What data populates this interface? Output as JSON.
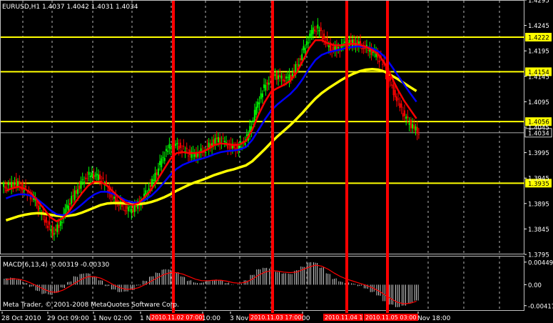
{
  "header": {
    "symbol_line": "EURUSD,H1  1.4037 1.4042 1.4031 1.4034",
    "indicator_line": "MACD(6,13,4) -0.00319 -0.00330"
  },
  "footer": {
    "copyright": "Meta Trader, © 2001-2008 MetaQuotes Software Corp."
  },
  "colors": {
    "background": "#000000",
    "up_candle": "#00ff00",
    "down_candle": "#ff0000",
    "ma_red": "#ff0000",
    "ma_blue": "#0000ff",
    "ma_yellow": "#ffff00",
    "level_line": "#ffff00",
    "event_line": "#ff0000",
    "macd_hist": "#ffffff",
    "signal": "#ff0000"
  },
  "chart_data": [
    {
      "type": "candlestick",
      "title": "EURUSD,H1",
      "ohlc_last": {
        "open": 1.4037,
        "high": 1.4042,
        "low": 1.4031,
        "close": 1.4034
      },
      "ylim": [
        1.3795,
        1.4295
      ],
      "y_ticks": [
        "1.4295",
        "1.4245",
        "1.4195",
        "1.4145",
        "1.4095",
        "1.4045",
        "1.3995",
        "1.3945",
        "1.3895",
        "1.3845",
        "1.3795"
      ],
      "x_ticks": [
        "28 Oct 2010",
        "29 Oct 09:00",
        "1 Nov 02:00",
        "1 N",
        "10:00",
        "3 Nov",
        "00",
        "Nov 18:00"
      ],
      "levels": [
        "1.4222",
        "1.4154",
        "1.4056",
        "1.3935"
      ],
      "current_price": "1.4034",
      "event_markers": [
        "2010.11.02 07:00",
        "2010.11.03 17:00",
        "2010.11.04 1",
        "2010.11.05 03:00"
      ],
      "close_series": [
        1.3928,
        1.3936,
        1.393,
        1.3916,
        1.3904,
        1.388,
        1.3858,
        1.3838,
        1.385,
        1.388,
        1.3904,
        1.3925,
        1.3945,
        1.3952,
        1.3948,
        1.3938,
        1.3918,
        1.39,
        1.389,
        1.3882,
        1.3886,
        1.39,
        1.3922,
        1.3942,
        1.3972,
        1.3998,
        1.4012,
        1.4008,
        1.3998,
        1.399,
        1.3993,
        1.4,
        1.4012,
        1.402,
        1.4016,
        1.4008,
        1.4004,
        1.4012,
        1.403,
        1.4072,
        1.411,
        1.4135,
        1.415,
        1.414,
        1.4138,
        1.415,
        1.4175,
        1.4205,
        1.4232,
        1.424,
        1.4218,
        1.42,
        1.4198,
        1.4205,
        1.421,
        1.4212,
        1.4205,
        1.4198,
        1.419,
        1.4175,
        1.415,
        1.4115,
        1.4085,
        1.406,
        1.4046,
        1.4034
      ],
      "ma_red": [
        1.392,
        1.3925,
        1.3928,
        1.3924,
        1.3915,
        1.39,
        1.3885,
        1.3868,
        1.386,
        1.3866,
        1.388,
        1.3898,
        1.3915,
        1.393,
        1.3938,
        1.3938,
        1.393,
        1.3918,
        1.3906,
        1.3896,
        1.3892,
        1.3896,
        1.3908,
        1.3922,
        1.3942,
        1.3962,
        1.3982,
        1.3994,
        1.3996,
        1.3994,
        1.3994,
        1.3996,
        1.4002,
        1.401,
        1.4013,
        1.4012,
        1.401,
        1.4011,
        1.4018,
        1.404,
        1.407,
        1.4095,
        1.4115,
        1.4122,
        1.4128,
        1.4136,
        1.4152,
        1.4175,
        1.42,
        1.4216,
        1.4216,
        1.421,
        1.4206,
        1.4206,
        1.4208,
        1.4209,
        1.4207,
        1.4203,
        1.4197,
        1.4188,
        1.417,
        1.4145,
        1.412,
        1.4098,
        1.408,
        1.4062
      ],
      "ma_blue": [
        1.3905,
        1.391,
        1.3913,
        1.3913,
        1.391,
        1.3903,
        1.3893,
        1.3882,
        1.3874,
        1.3872,
        1.3875,
        1.3883,
        1.3893,
        1.3904,
        1.3913,
        1.3918,
        1.3918,
        1.3914,
        1.3908,
        1.3901,
        1.3897,
        1.3897,
        1.3902,
        1.391,
        1.3922,
        1.3936,
        1.3951,
        1.3963,
        1.3971,
        1.3976,
        1.398,
        1.3983,
        1.3987,
        1.3992,
        1.3996,
        1.3998,
        1.3999,
        1.4001,
        1.4006,
        1.402,
        1.404,
        1.406,
        1.4078,
        1.409,
        1.41,
        1.411,
        1.4123,
        1.414,
        1.416,
        1.4177,
        1.4187,
        1.4192,
        1.4195,
        1.4198,
        1.4201,
        1.4203,
        1.4204,
        1.4203,
        1.42,
        1.4194,
        1.4183,
        1.4166,
        1.4148,
        1.413,
        1.4112,
        1.4095
      ],
      "ma_yellow": [
        1.3862,
        1.3866,
        1.387,
        1.3873,
        1.3875,
        1.3876,
        1.3875,
        1.3873,
        1.3871,
        1.387,
        1.3871,
        1.3873,
        1.3877,
        1.3882,
        1.3887,
        1.3892,
        1.3895,
        1.3896,
        1.3896,
        1.3895,
        1.3894,
        1.3894,
        1.3895,
        1.3898,
        1.3902,
        1.3907,
        1.3913,
        1.392,
        1.3926,
        1.3932,
        1.3937,
        1.3941,
        1.3946,
        1.3951,
        1.3955,
        1.3959,
        1.3962,
        1.3966,
        1.397,
        1.3978,
        1.399,
        1.4002,
        1.4015,
        1.4027,
        1.4038,
        1.4049,
        1.4061,
        1.4074,
        1.4088,
        1.4101,
        1.4112,
        1.4121,
        1.4129,
        1.4137,
        1.4144,
        1.415,
        1.4155,
        1.4158,
        1.4159,
        1.4158,
        1.4154,
        1.4147,
        1.414,
        1.4132,
        1.4124,
        1.4116
      ]
    },
    {
      "type": "bar",
      "title": "MACD(6,13,4)",
      "macd": -0.00319,
      "signal": -0.0033,
      "ylim": [
        -0.0052,
        0.0056
      ],
      "y_ticks": [
        "0.00449",
        "0.00",
        "-0.00417"
      ],
      "histogram": [
        0.0012,
        0.0014,
        0.001,
        0.0004,
        -0.0004,
        -0.0012,
        -0.0018,
        -0.002,
        -0.0016,
        -0.0006,
        0.0006,
        0.0016,
        0.0022,
        0.0022,
        0.0016,
        0.0008,
        -0.0002,
        -0.001,
        -0.0014,
        -0.0014,
        -0.001,
        -0.0002,
        0.0008,
        0.0016,
        0.0024,
        0.003,
        0.003,
        0.0024,
        0.0016,
        0.0008,
        0.0004,
        0.0004,
        0.0008,
        0.001,
        0.0008,
        0.0004,
        0.0,
        0.0002,
        0.0008,
        0.002,
        0.003,
        0.0034,
        0.0032,
        0.0026,
        0.0022,
        0.0022,
        0.0028,
        0.0036,
        0.0044,
        0.0044,
        0.0034,
        0.0022,
        0.0012,
        0.0006,
        0.0004,
        0.0002,
        -0.0002,
        -0.0008,
        -0.0014,
        -0.0022,
        -0.0032,
        -0.004,
        -0.0044,
        -0.0042,
        -0.0036,
        -0.0032
      ],
      "signal_series": [
        0.001,
        0.0012,
        0.0011,
        0.0008,
        0.0003,
        -0.0003,
        -0.0009,
        -0.0014,
        -0.0015,
        -0.0011,
        -0.0004,
        0.0004,
        0.0011,
        0.0016,
        0.0016,
        0.0013,
        0.0007,
        0.0,
        -0.0006,
        -0.0009,
        -0.0009,
        -0.0006,
        0.0,
        0.0007,
        0.0014,
        0.002,
        0.0024,
        0.0024,
        0.0021,
        0.0016,
        0.0011,
        0.0008,
        0.0008,
        0.0009,
        0.0009,
        0.0007,
        0.0004,
        0.0003,
        0.0005,
        0.0011,
        0.0019,
        0.0025,
        0.0028,
        0.0027,
        0.0025,
        0.0024,
        0.0025,
        0.003,
        0.0035,
        0.0039,
        0.0037,
        0.0031,
        0.0023,
        0.0016,
        0.0011,
        0.0007,
        0.0003,
        -0.0001,
        -0.0006,
        -0.0012,
        -0.002,
        -0.0028,
        -0.0035,
        -0.0038,
        -0.0037,
        -0.0033
      ]
    }
  ]
}
